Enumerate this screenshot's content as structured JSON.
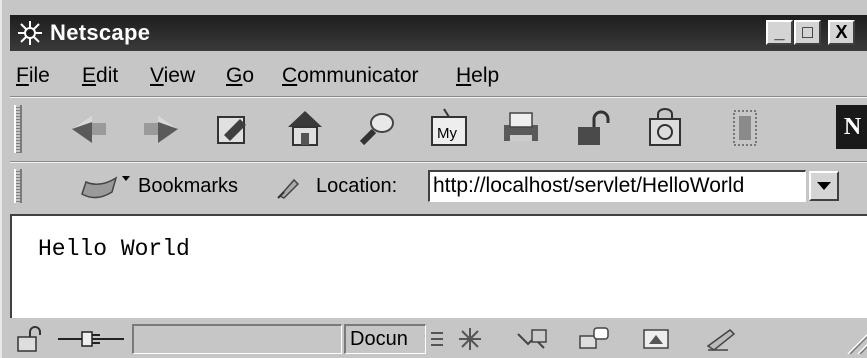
{
  "window": {
    "title": "Netscape"
  },
  "title_buttons": {
    "minimize": "_",
    "maximize": "□",
    "close": "X"
  },
  "menu": [
    {
      "label": "File",
      "accel": "F",
      "rest": "ile"
    },
    {
      "label": "Edit",
      "accel": "E",
      "rest": "dit"
    },
    {
      "label": "View",
      "accel": "V",
      "rest": "iew"
    },
    {
      "label": "Go",
      "accel": "G",
      "rest": "o"
    },
    {
      "label": "Communicator",
      "accel": "C",
      "rest": "ommunicator"
    },
    {
      "label": "Help",
      "accel": "H",
      "rest": "elp"
    }
  ],
  "toolbar": {
    "buttons": [
      "back-icon",
      "forward-icon",
      "reload-icon",
      "home-icon",
      "search-icon",
      "my-netscape-icon",
      "print-icon",
      "security-icon",
      "shop-icon",
      "stop-icon"
    ],
    "brand": "N"
  },
  "location_bar": {
    "bookmarks_label": "Bookmarks",
    "location_label": "Location:",
    "url": "http://localhost/servlet/HelloWorld"
  },
  "page": {
    "body_text": "Hello World"
  },
  "status_bar": {
    "document_text": "Docun"
  }
}
